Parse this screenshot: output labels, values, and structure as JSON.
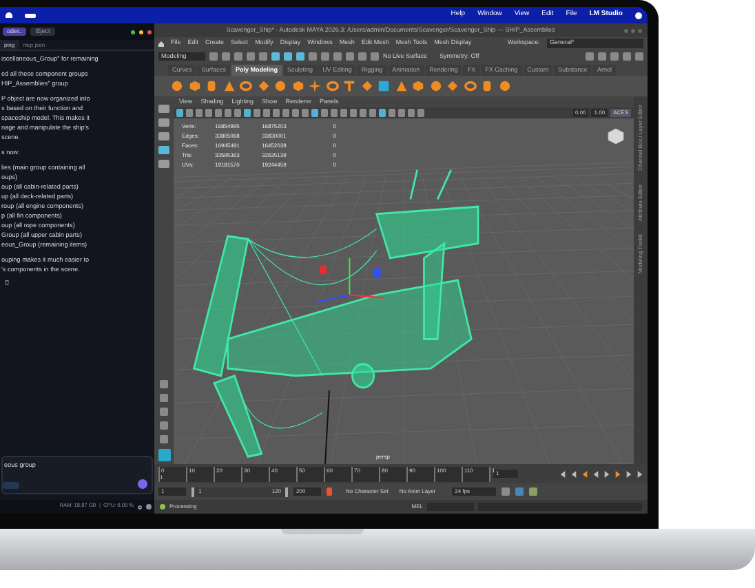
{
  "menubar": {
    "items": [
      "Help",
      "Window",
      "View",
      "Edit",
      "File",
      "LM Studio"
    ]
  },
  "chat": {
    "model_select": "oder..",
    "eject": "Eject",
    "tabs": [
      {
        "label": "ping",
        "selected": true
      },
      {
        "label": "mcp.json",
        "selected": false
      }
    ],
    "blocks": [
      [
        "iscellaneous_Group\" for remaining"
      ],
      [
        "ed all these component groups",
        "HIP_Assemblies\" group"
      ],
      [
        "P object are now organized into",
        "s based on their function and",
        "spaceship model. This makes it",
        "nage and manipulate the ship's",
        "scene."
      ],
      [
        "s now:"
      ],
      [
        "lies (main group containing all",
        "oups)",
        "oup (all cabin-related parts)",
        "up (all deck-related parts)",
        "roup (all engine components)",
        "p (all fin components)",
        "oup (all rope components)",
        "Group (all upper cabin parts)",
        "eous_Group (remaining items)"
      ],
      [
        "ouping makes it much easier to",
        "'s components in the scene."
      ]
    ],
    "input_value": "eous group",
    "status": "RAM: 18.87 GB  |  CPU: 0.00 %"
  },
  "maya": {
    "title": "Scavenger_Ship* - Autodesk MAYA 2026.3: /Users/admin/Documents/Scavenger/Scavenger_Ship  ---  SHIP_Assemblies",
    "menus": [
      "File",
      "Edit",
      "Create",
      "Select",
      "Modify",
      "Display",
      "Windows",
      "Mesh",
      "Edit Mesh",
      "Mesh Tools",
      "Mesh Display"
    ],
    "workspace_label": "Workspace:",
    "workspace": "General*",
    "mode": "Modeling",
    "live_surface": "No Live Surface",
    "symmetry": "Symmetry: Off",
    "shelf_tabs": [
      {
        "label": "Curves",
        "selected": false
      },
      {
        "label": "Surfaces",
        "selected": false
      },
      {
        "label": "Poly Modeling",
        "selected": true
      },
      {
        "label": "Sculpting",
        "selected": false
      },
      {
        "label": "UV Editing",
        "selected": false
      },
      {
        "label": "Rigging",
        "selected": false
      },
      {
        "label": "Animation",
        "selected": false
      },
      {
        "label": "Rendering",
        "selected": false
      },
      {
        "label": "FX",
        "selected": false
      },
      {
        "label": "FX Caching",
        "selected": false
      },
      {
        "label": "Custom",
        "selected": false
      },
      {
        "label": "Substance",
        "selected": false
      },
      {
        "label": "Arnol",
        "selected": false
      }
    ],
    "panel_menus": [
      "View",
      "Shading",
      "Lighting",
      "Show",
      "Renderer",
      "Panels"
    ],
    "exposure": "0.00",
    "gamma": "1.00",
    "color_space": "ACES",
    "stats": [
      {
        "label": "Verts:",
        "values": [
          "16854995",
          "16875203",
          "0"
        ]
      },
      {
        "label": "Edges:",
        "values": [
          "33805068",
          "33830001",
          "0"
        ]
      },
      {
        "label": "Faces:",
        "values": [
          "16945491",
          "16452038",
          "0"
        ]
      },
      {
        "label": "Tris:",
        "values": [
          "33595363",
          "32635139",
          "0"
        ]
      },
      {
        "label": "UVs:",
        "values": [
          "19181570",
          "19244459",
          "0"
        ]
      }
    ],
    "camera": "persp",
    "side_tabs": [
      "Channel Box / Layer Editor",
      "Attribute Editor",
      "Modeling Toolkit"
    ],
    "timeline": {
      "ticks": [
        "0",
        "10",
        "20",
        "30",
        "40",
        "50",
        "60",
        "70",
        "80",
        "90",
        "100",
        "110",
        "1"
      ],
      "marker": "1",
      "current": "1"
    },
    "range": {
      "level": 1,
      "start": "1",
      "range_start": "1",
      "range_end": "120",
      "end": "200",
      "character_set": "No Character Set",
      "anim_layer": "No Anim Layer",
      "fps": "24 fps"
    },
    "status": "Processing",
    "command_label": "MEL"
  }
}
